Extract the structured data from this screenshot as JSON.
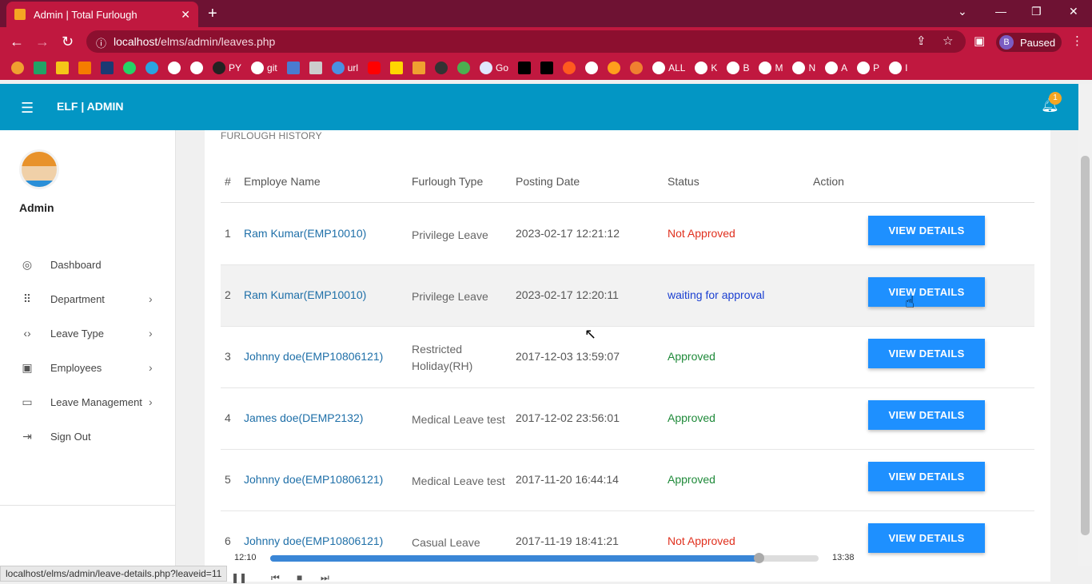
{
  "browser": {
    "tab_title": "Admin | Total Furlough",
    "url_host": "localhost",
    "url_path": "/elms/admin/leaves.php",
    "profile_initial": "B",
    "profile_status": "Paused",
    "bookmarks": [
      "PY",
      "git",
      "url",
      "Go",
      "ALL",
      "K",
      "B",
      "M",
      "N",
      "A",
      "P",
      "I"
    ]
  },
  "header": {
    "brand": "ELF | ADMIN",
    "notification_count": "1"
  },
  "sidebar": {
    "user_name": "Admin",
    "items": [
      {
        "label": "Dashboard",
        "icon": "palette-icon",
        "has_chevron": false
      },
      {
        "label": "Department",
        "icon": "grid-icon",
        "has_chevron": true
      },
      {
        "label": "Leave Type",
        "icon": "code-icon",
        "has_chevron": true
      },
      {
        "label": "Employees",
        "icon": "person-card-icon",
        "has_chevron": true
      },
      {
        "label": "Leave Management",
        "icon": "desktop-icon",
        "has_chevron": true
      },
      {
        "label": "Sign Out",
        "icon": "sign-out-icon",
        "has_chevron": false
      }
    ]
  },
  "main": {
    "section_title": "FURLOUGH HISTORY",
    "columns": [
      "#",
      "Employe Name",
      "Furlough Type",
      "Posting Date",
      "Status",
      "Action"
    ],
    "rows": [
      {
        "num": "1",
        "name": "Ram Kumar(EMP10010)",
        "type": "Privilege Leave",
        "date": "2023-02-17 12:21:12",
        "status": "Not Approved",
        "status_color": "#e0301e",
        "action": "VIEW DETAILS"
      },
      {
        "num": "2",
        "name": "Ram Kumar(EMP10010)",
        "type": "Privilege Leave",
        "date": "2023-02-17 12:20:11",
        "status": "waiting for approval",
        "status_color": "#1a3fd1",
        "action": "VIEW DETAILS"
      },
      {
        "num": "3",
        "name": "Johnny doe(EMP10806121)",
        "type": "Restricted Holiday(RH)",
        "date": "2017-12-03 13:59:07",
        "status": "Approved",
        "status_color": "#1f8a3a",
        "action": "VIEW DETAILS"
      },
      {
        "num": "4",
        "name": "James doe(DEMP2132)",
        "type": "Medical Leave test",
        "date": "2017-12-02 23:56:01",
        "status": "Approved",
        "status_color": "#1f8a3a",
        "action": "VIEW DETAILS"
      },
      {
        "num": "5",
        "name": "Johnny doe(EMP10806121)",
        "type": "Medical Leave test",
        "date": "2017-11-20 16:44:14",
        "status": "Approved",
        "status_color": "#1f8a3a",
        "action": "VIEW DETAILS"
      },
      {
        "num": "6",
        "name": "Johnny doe(EMP10806121)",
        "type": "Casual Leave",
        "date": "2017-11-19 18:41:21",
        "status": "Not Approved",
        "status_color": "#e0301e",
        "action": "VIEW DETAILS"
      }
    ]
  },
  "status_bar_url": "localhost/elms/admin/leave-details.php?leaveid=11",
  "player": {
    "elapsed": "12:10",
    "total": "13:38",
    "progress": 0.89
  }
}
